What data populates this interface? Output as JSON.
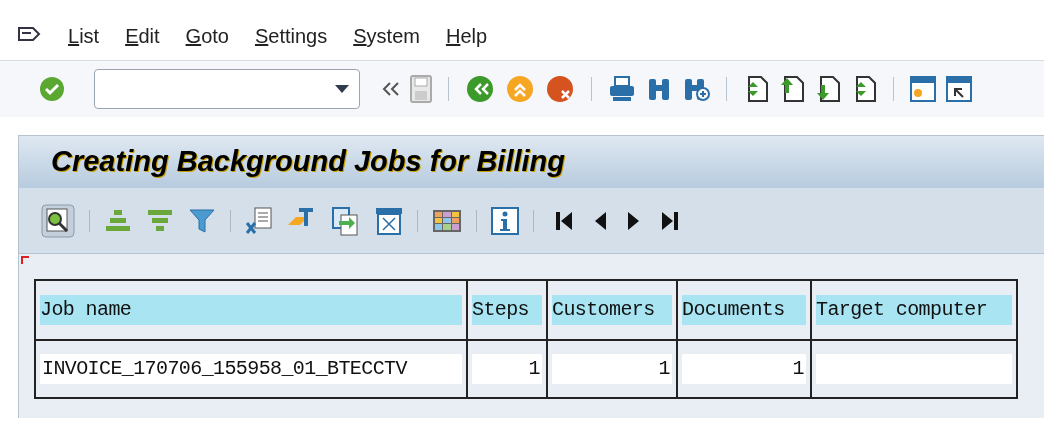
{
  "menu_bar": {
    "items": [
      {
        "label": "List"
      },
      {
        "label": "Edit"
      },
      {
        "label": "Goto"
      },
      {
        "label": "Settings"
      },
      {
        "label": "System"
      },
      {
        "label": "Help"
      }
    ]
  },
  "title": "Creating Background Jobs for Billing",
  "table": {
    "columns": [
      "Job name",
      "Steps",
      "Customers",
      "Documents",
      "Target computer"
    ],
    "rows": [
      {
        "cells": [
          "INVOICE_170706_155958_01_BTECCTV",
          "1",
          "1",
          "1",
          ""
        ]
      }
    ]
  }
}
